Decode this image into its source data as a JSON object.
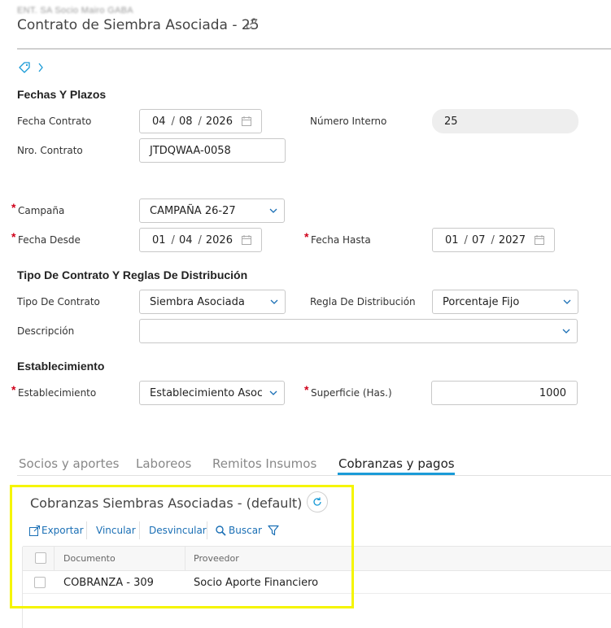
{
  "breadcrumb": "ENT. SA Socio Mairo GABA",
  "page_title": "Contrato de Siembra Asociada - 25",
  "sections": {
    "fechas": "Fechas Y Plazos",
    "tipo": "Tipo De Contrato Y Reglas De Distribución",
    "establecimiento": "Establecimiento"
  },
  "fields": {
    "fecha_contrato": {
      "label": "Fecha Contrato",
      "day": "04",
      "month": "08",
      "year": "2026"
    },
    "numero_interno": {
      "label": "Número Interno",
      "value": "25"
    },
    "nro_contrato": {
      "label": "Nro. Contrato",
      "value": "JTDQWAA-0058"
    },
    "campana": {
      "label": "Campaña",
      "value": "CAMPAÑA 26-27"
    },
    "fecha_desde": {
      "label": "Fecha Desde",
      "day": "01",
      "month": "04",
      "year": "2026"
    },
    "fecha_hasta": {
      "label": "Fecha Hasta",
      "day": "01",
      "month": "07",
      "year": "2027"
    },
    "tipo_contrato": {
      "label": "Tipo De Contrato",
      "value": "Siembra Asociada"
    },
    "regla_distribucion": {
      "label": "Regla De Distribución",
      "value": "Porcentaje Fijo"
    },
    "descripcion": {
      "label": "Descripción",
      "value": ""
    },
    "establecimiento": {
      "label": "Establecimiento",
      "value": "Establecimiento Asociac"
    },
    "superficie": {
      "label": "Superficie (Has.)",
      "value": "1000"
    }
  },
  "required_mark": "*",
  "tabs": [
    {
      "label": "Socios y aportes"
    },
    {
      "label": "Laboreos"
    },
    {
      "label": "Remitos Insumos"
    },
    {
      "label": "Cobranzas y pagos"
    }
  ],
  "subgrid": {
    "title": "Cobranzas Siembras Asociadas - (default)",
    "toolbar": {
      "exportar": "Exportar",
      "vincular": "Vincular",
      "desvincular": "Desvincular",
      "buscar": "Buscar"
    },
    "columns": [
      "Documento",
      "Proveedor"
    ],
    "rows": [
      {
        "documento": "COBRANZA - 309",
        "proveedor": "Socio Aporte Financiero"
      }
    ]
  },
  "colors": {
    "accent": "#1a9bd7",
    "link": "#1a6fb5",
    "required": "#d0021b",
    "highlight": "#f5f500"
  },
  "icons": [
    "link-icon",
    "tag-icon",
    "chevron-right-icon",
    "calendar-icon",
    "chevron-down-icon",
    "refresh-icon",
    "export-icon",
    "search-icon",
    "filter-icon"
  ]
}
